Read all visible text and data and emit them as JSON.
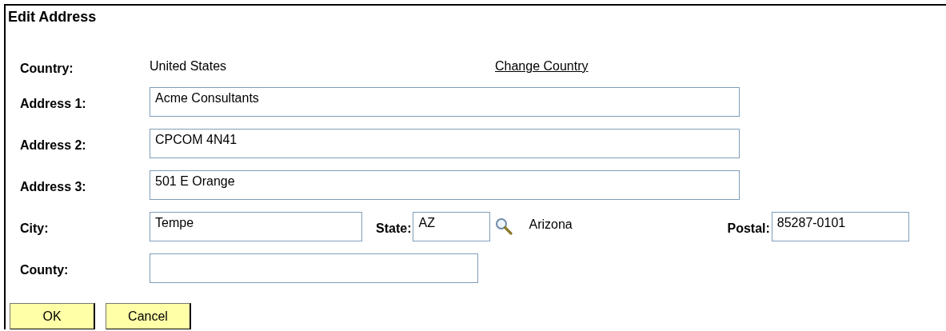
{
  "title": "Edit Address",
  "country": {
    "label": "Country:",
    "value": "United States",
    "link": "Change Country"
  },
  "address_fields": [
    {
      "label": "Address 1:",
      "value": "Acme Consultants"
    },
    {
      "label": "Address 2:",
      "value": "CPCOM 4N41"
    },
    {
      "label": "Address 3:",
      "value": "501 E Orange"
    }
  ],
  "city": {
    "label": "City:",
    "value": "Tempe"
  },
  "state": {
    "label": "State:",
    "value": "AZ",
    "name": "Arizona"
  },
  "postal": {
    "label": "Postal:",
    "value": "85287-0101"
  },
  "county": {
    "label": "County:"
  },
  "buttons": [
    "OK",
    "Cancel"
  ]
}
